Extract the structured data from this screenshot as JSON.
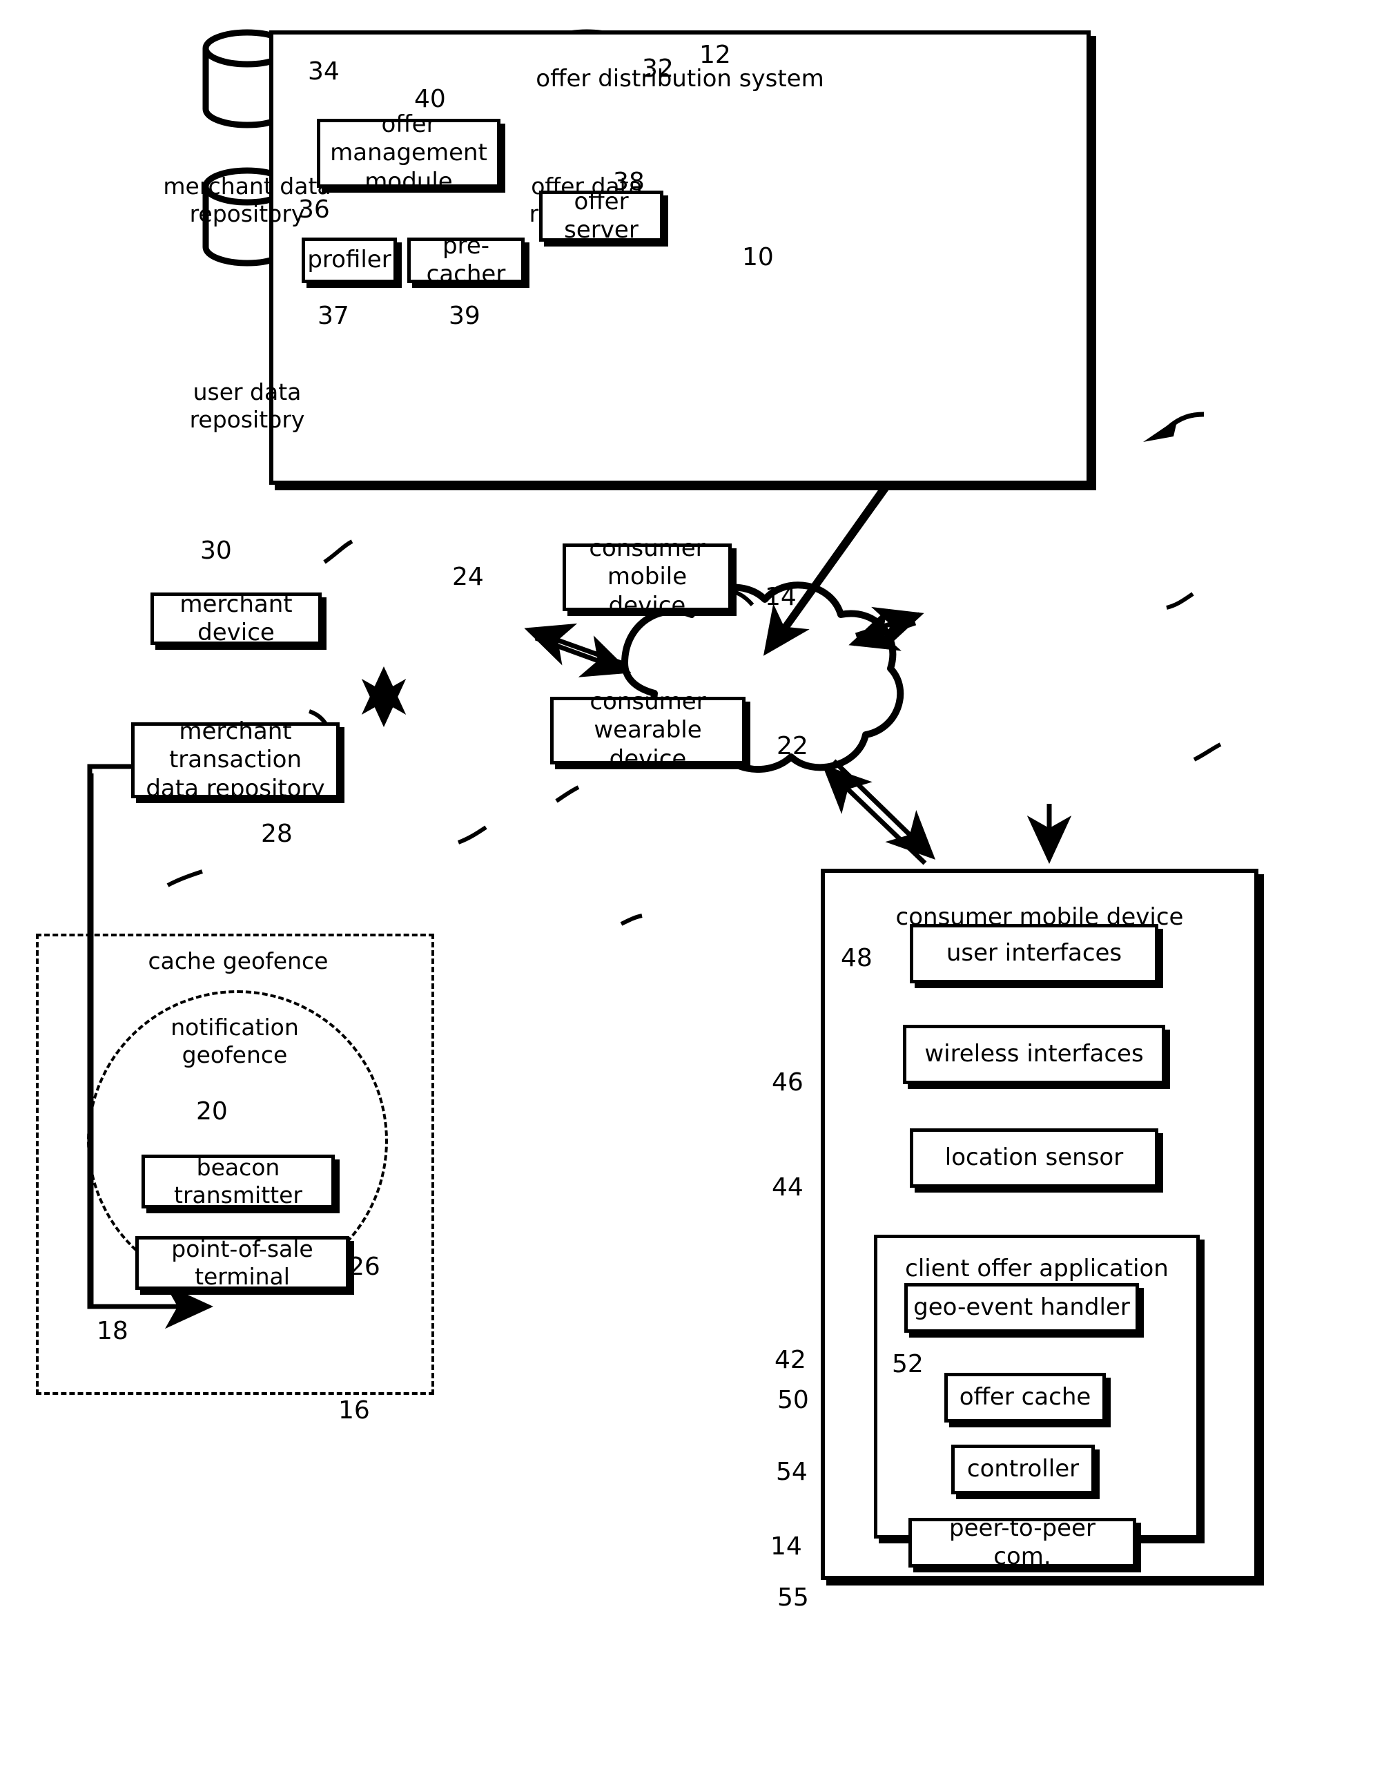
{
  "figure": {
    "type": "patent-block-diagram",
    "overall_ref": "10"
  },
  "offer_distribution_system": {
    "title": "offer distribution system",
    "ref": "12",
    "merchant_data_repository": {
      "label": "merchant data\nrepository",
      "ref": "34"
    },
    "user_data_repository": {
      "label": "user data\nrepository",
      "ref": "36"
    },
    "offer_data_repository": {
      "label": "offer data\nrepository",
      "ref": "32"
    },
    "offer_management_module": {
      "label": "offer management\nmodule",
      "ref": "40"
    },
    "profiler": {
      "label": "profiler",
      "ref": "37"
    },
    "pre_cacher": {
      "label": "pre-cacher",
      "ref": "39"
    },
    "offer_server": {
      "label": "offer server",
      "ref": "38"
    }
  },
  "network": {
    "cloud_ref": "24"
  },
  "merchant": {
    "merchant_device": {
      "label": "merchant device",
      "ref": "30"
    },
    "merchant_transaction_data_repository": {
      "label": "merchant transaction\ndata repository",
      "ref": "28"
    }
  },
  "consumer_top": {
    "consumer_mobile_device": {
      "label": "consumer mobile\ndevice",
      "ref": "14"
    },
    "consumer_wearable_device": {
      "label": "consumer wearable\ndevice",
      "ref": "22"
    }
  },
  "geofence": {
    "cache_geofence": {
      "label": "cache geofence",
      "ref": "16"
    },
    "notification_geofence": {
      "label": "notification\ngeofence",
      "ref": "18"
    },
    "beacon_transmitter": {
      "label": "beacon transmitter",
      "ref": "20"
    },
    "point_of_sale_terminal": {
      "label": "point-of-sale terminal",
      "ref": "26"
    }
  },
  "consumer_mobile_device_detail": {
    "title": "consumer mobile device",
    "ref": "14",
    "user_interfaces": {
      "label": "user interfaces",
      "ref": "48"
    },
    "wireless_interfaces": {
      "label": "wireless interfaces",
      "ref": "46"
    },
    "location_sensor": {
      "label": "location sensor",
      "ref": "44"
    },
    "client_offer_application": {
      "label": "client offer application",
      "ref": "42"
    },
    "geo_event_handler": {
      "label": "geo-event handler",
      "ref": "52"
    },
    "offer_cache": {
      "label": "offer cache",
      "ref": "50"
    },
    "controller": {
      "label": "controller",
      "ref": "54"
    },
    "peer_to_peer_com": {
      "label": "peer-to-peer com.",
      "ref": "55"
    }
  }
}
